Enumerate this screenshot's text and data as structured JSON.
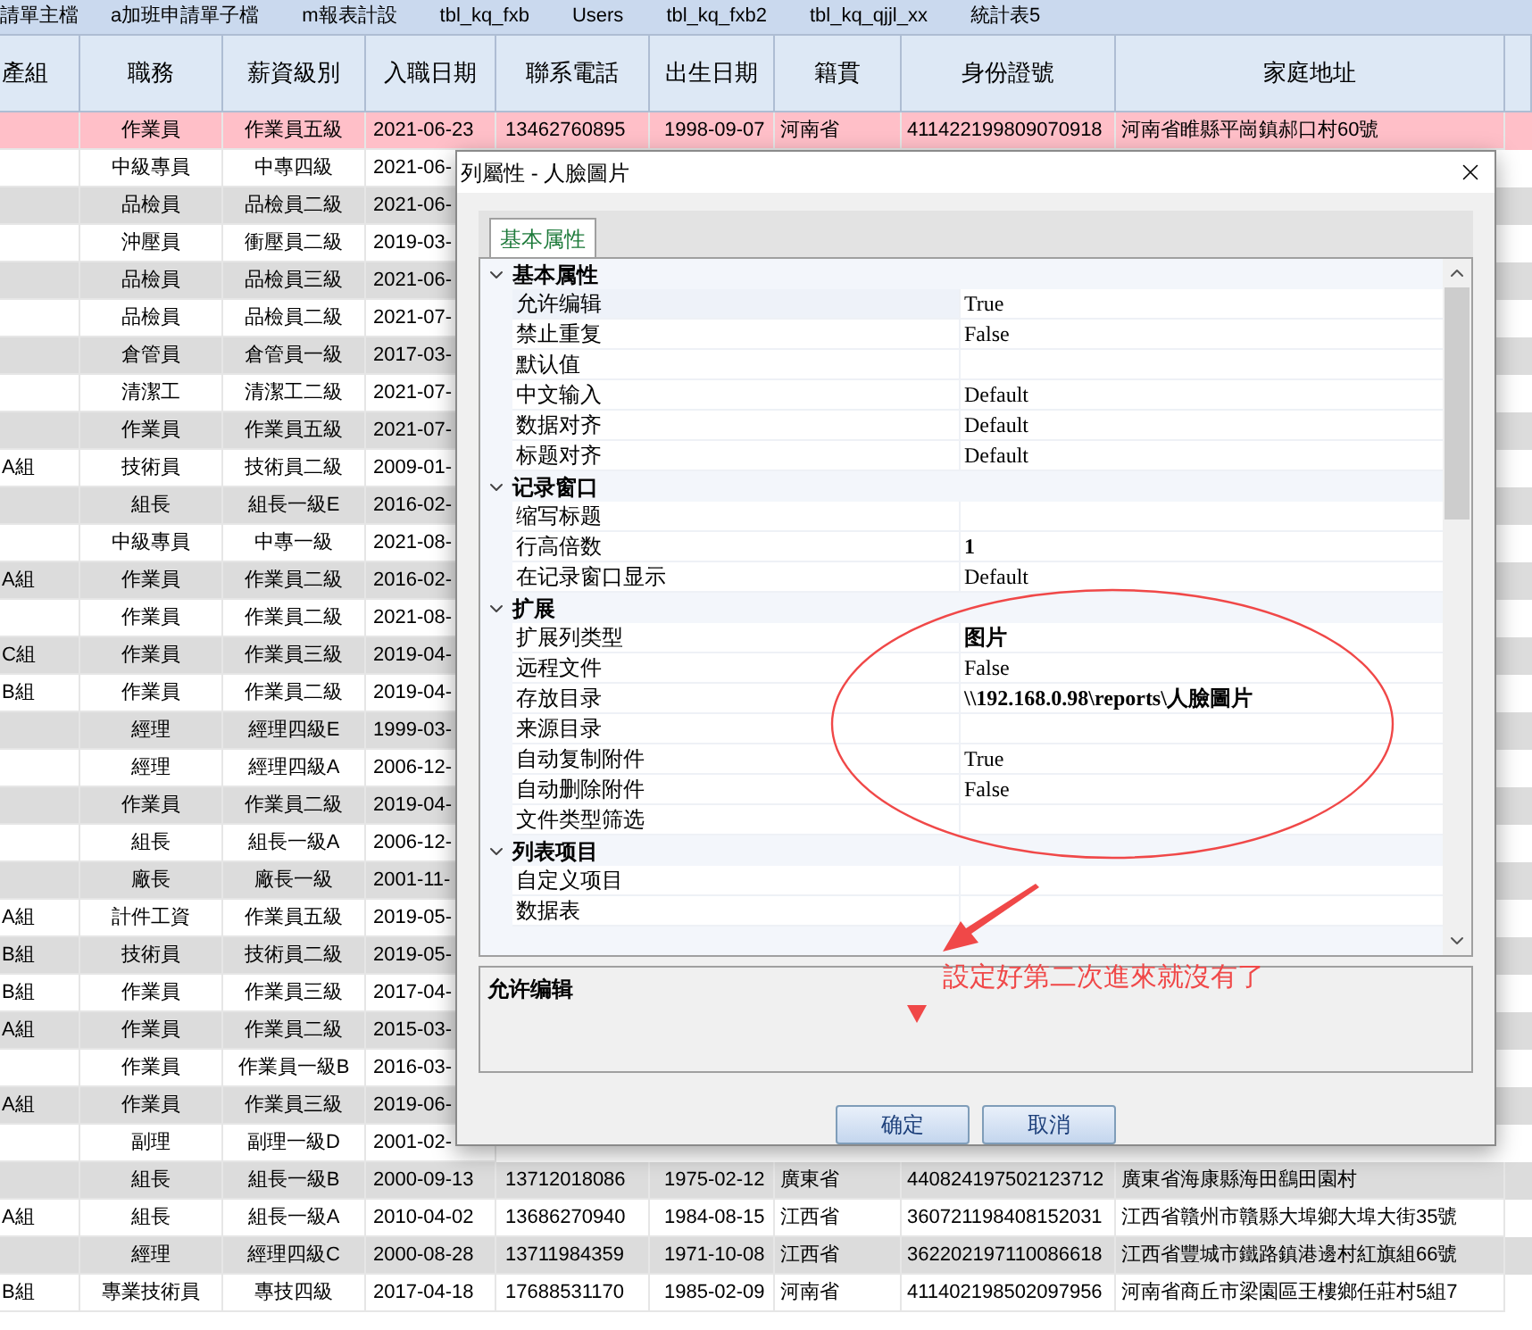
{
  "tabs": [
    {
      "label": "請單主檔"
    },
    {
      "label": "a加班申請單子檔"
    },
    {
      "label": "m報表計設"
    },
    {
      "label": "tbl_kq_fxb"
    },
    {
      "label": "Users"
    },
    {
      "label": "tbl_kq_fxb2"
    },
    {
      "label": "tbl_kq_qjjl_xx"
    },
    {
      "label": "統計表5"
    }
  ],
  "table": {
    "columns": [
      "產組",
      "職務",
      "薪資級別",
      "入職日期",
      "聯系電話",
      "出生日期",
      "籍貫",
      "身份證號",
      "家庭地址"
    ],
    "rows": [
      {
        "selected": true,
        "job": "作業員",
        "grade": "作業員五級",
        "hire_date": "2021-06-23",
        "phone": "13462760895",
        "birth_date": "1998-09-07",
        "native_place": "河南省",
        "id_number": "411422199809070918",
        "address": "河南省睢縣平崗鎮郝口村60號"
      },
      {
        "selected": false,
        "job": "中級專員",
        "grade": "中專四級",
        "hire_date": "2021-06-"
      },
      {
        "selected": false,
        "job": "品檢員",
        "grade": "品檢員二級",
        "hire_date": "2021-06-"
      },
      {
        "selected": false,
        "job": "沖壓員",
        "grade": "衝壓員二級",
        "hire_date": "2019-03-"
      },
      {
        "selected": false,
        "job": "品檢員",
        "grade": "品檢員三級",
        "hire_date": "2021-06-"
      },
      {
        "selected": false,
        "job": "品檢員",
        "grade": "品檢員二級",
        "hire_date": "2021-07-"
      },
      {
        "selected": false,
        "job": "倉管員",
        "grade": "倉管員一級",
        "hire_date": "2017-03-"
      },
      {
        "selected": false,
        "job": "清潔工",
        "grade": "清潔工二級",
        "hire_date": "2021-07-"
      },
      {
        "selected": false,
        "job": "作業員",
        "grade": "作業員五級",
        "hire_date": "2021-07-"
      },
      {
        "selected": false,
        "column_1": "A組",
        "job": "技術員",
        "grade": "技術員二級",
        "hire_date": "2009-01-"
      },
      {
        "selected": false,
        "job": "組長",
        "grade": "組長一級E",
        "hire_date": "2016-02-"
      },
      {
        "selected": false,
        "job": "中級專員",
        "grade": "中專一級",
        "hire_date": "2021-08-"
      },
      {
        "selected": false,
        "column_1": "A組",
        "job": "作業員",
        "grade": "作業員二級",
        "hire_date": "2016-02-"
      },
      {
        "selected": false,
        "job": "作業員",
        "grade": "作業員二級",
        "hire_date": "2021-08-"
      },
      {
        "selected": false,
        "column_1": "C組",
        "job": "作業員",
        "grade": "作業員三級",
        "hire_date": "2019-04-"
      },
      {
        "selected": false,
        "column_1": "B組",
        "job": "作業員",
        "grade": "作業員二級",
        "hire_date": "2019-04-"
      },
      {
        "selected": false,
        "job": "經理",
        "grade": "經理四級E",
        "hire_date": "1999-03-"
      },
      {
        "selected": false,
        "job": "經理",
        "grade": "經理四級A",
        "hire_date": "2006-12-"
      },
      {
        "selected": false,
        "job": "作業員",
        "grade": "作業員二級",
        "hire_date": "2019-04-"
      },
      {
        "selected": false,
        "job": "組長",
        "grade": "組長一級A",
        "hire_date": "2006-12-"
      },
      {
        "selected": false,
        "job": "廠長",
        "grade": "廠長一級",
        "hire_date": "2001-11-"
      },
      {
        "selected": false,
        "column_1": "A組",
        "job": "計件工資",
        "grade": "作業員五級",
        "hire_date": "2019-05-"
      },
      {
        "selected": false,
        "column_1": "B組",
        "job": "技術員",
        "grade": "技術員二級",
        "hire_date": "2019-05-"
      },
      {
        "selected": false,
        "column_1": "B組",
        "job": "作業員",
        "grade": "作業員三級",
        "hire_date": "2017-04-"
      },
      {
        "selected": false,
        "column_1": "A組",
        "job": "作業員",
        "grade": "作業員二級",
        "hire_date": "2015-03-"
      },
      {
        "selected": false,
        "job": "作業員",
        "grade": "作業員一級B",
        "hire_date": "2016-03-"
      },
      {
        "selected": false,
        "column_1": "A組",
        "job": "作業員",
        "grade": "作業員三級",
        "hire_date": "2019-06-"
      },
      {
        "selected": false,
        "job": "副理",
        "grade": "副理一級D",
        "hire_date": "2001-02-"
      },
      {
        "selected": false,
        "job": "組長",
        "grade": "組長一級B",
        "hire_date": "2000-09-13",
        "phone": "13712018086",
        "birth_date": "1975-02-12",
        "native_place": "廣東省",
        "id_number": "440824197502123712",
        "address": "廣東省海康縣海田鷂田園村"
      },
      {
        "selected": false,
        "column_1": "A組",
        "job": "組長",
        "grade": "組長一級A",
        "hire_date": "2010-04-02",
        "phone": "13686270940",
        "birth_date": "1984-08-15",
        "native_place": "江西省",
        "id_number": "360721198408152031",
        "address": "江西省贛州市贛縣大埠鄉大埠大街35號"
      },
      {
        "selected": false,
        "job": "經理",
        "grade": "經理四級C",
        "hire_date": "2000-08-28",
        "phone": "13711984359",
        "birth_date": "1971-10-08",
        "native_place": "江西省",
        "id_number": "362202197110086618",
        "address": "江西省豐城市鐵路鎮港邊村紅旗組66號"
      },
      {
        "selected": false,
        "column_1": "B組",
        "job": "專業技術員",
        "grade": "專技四級",
        "hire_date": "2017-04-18",
        "phone": "17688531170",
        "birth_date": "1985-02-09",
        "native_place": "河南省",
        "id_number": "411402198502097956",
        "address": "河南省商丘市梁園區王樓鄉任莊村5組7"
      }
    ]
  },
  "dialog": {
    "title": "列屬性 - 人臉圖片",
    "tabs": [
      {
        "label": "基本属性",
        "selected": true
      }
    ],
    "categories": [
      {
        "title": "基本属性",
        "expanded": true,
        "items": [
          {
            "name": "允许编辑",
            "value": "True",
            "bold": false,
            "selected": true
          },
          {
            "name": "禁止重复",
            "value": "False",
            "bold": false,
            "selected": false
          },
          {
            "name": "默认值",
            "selected": false
          },
          {
            "name": "中文输入",
            "value": "Default",
            "bold": false,
            "selected": false
          },
          {
            "name": "数据对齐",
            "value": "Default",
            "bold": false,
            "selected": false
          },
          {
            "name": "标题对齐",
            "value": "Default",
            "bold": false,
            "selected": false
          }
        ]
      },
      {
        "title": "记录窗口",
        "expanded": true,
        "items": [
          {
            "name": "缩写标题",
            "selected": false
          },
          {
            "name": "行高倍数",
            "value": "1",
            "bold": true,
            "selected": false
          },
          {
            "name": "在记录窗口显示",
            "value": "Default",
            "bold": false,
            "selected": false
          }
        ]
      },
      {
        "title": "扩展",
        "expanded": true,
        "items": [
          {
            "name": "扩展列类型",
            "value": "图片",
            "bold": true,
            "selected": false
          },
          {
            "name": "远程文件",
            "value": "False",
            "bold": false,
            "selected": false
          },
          {
            "name": "存放目录",
            "value": "\\\\192.168.0.98\\reports\\人臉圖片",
            "bold": true,
            "selected": false
          },
          {
            "name": "来源目录",
            "selected": false
          },
          {
            "name": "自动复制附件",
            "value": "True",
            "bold": false,
            "selected": false
          },
          {
            "name": "自动删除附件",
            "value": "False",
            "bold": false,
            "selected": false
          },
          {
            "name": "文件类型筛选",
            "selected": false
          }
        ]
      },
      {
        "title": "列表项目",
        "expanded": true,
        "items": [
          {
            "name": "自定义项目",
            "selected": false
          },
          {
            "name": "数据表",
            "selected": false
          }
        ]
      }
    ],
    "description": {
      "title": "允许编辑"
    },
    "buttons": [
      "确定",
      "取消"
    ],
    "annotation": {
      "text": "設定好第二次進來就沒有了"
    }
  }
}
